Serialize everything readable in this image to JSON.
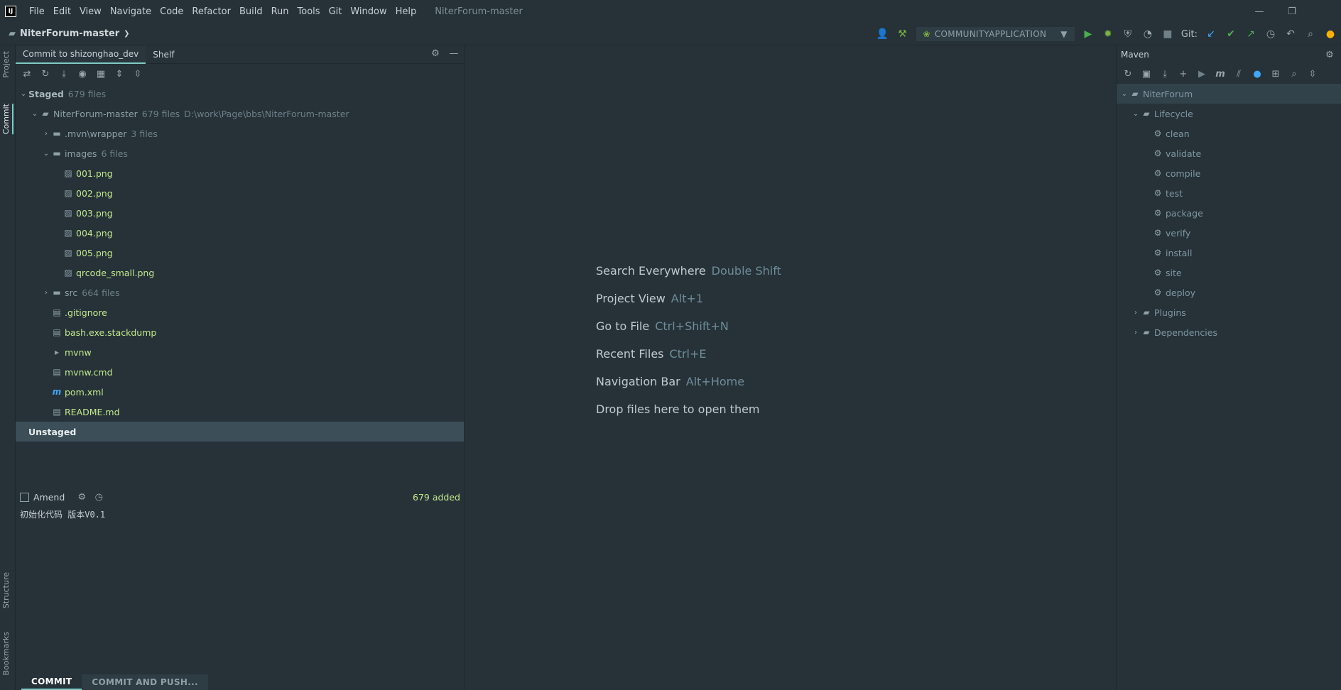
{
  "menu": [
    "File",
    "Edit",
    "View",
    "Navigate",
    "Code",
    "Refactor",
    "Build",
    "Run",
    "Tools",
    "Git",
    "Window",
    "Help"
  ],
  "window_title": "NiterForum-master",
  "breadcrumb": {
    "project": "NiterForum-master",
    "sep": "❯"
  },
  "run_config": "COMMUNITYAPPLICATION",
  "git_label": "Git:",
  "left_tabs": {
    "project": "Project",
    "commit": "Commit",
    "structure": "Structure",
    "bookmarks": "Bookmarks"
  },
  "commit_tabs": {
    "commit": "Commit to shizonghao_dev",
    "shelf": "Shelf"
  },
  "tree": {
    "staged": {
      "label": "Staged",
      "count": "679 files"
    },
    "root": {
      "label": "NiterForum-master",
      "count": "679 files",
      "path": "D:\\work\\Page\\bbs\\NiterForum-master"
    },
    "mvn": {
      "label": ".mvn\\wrapper",
      "count": "3 files"
    },
    "images": {
      "label": "images",
      "count": "6 files"
    },
    "image_files": [
      "001.png",
      "002.png",
      "003.png",
      "004.png",
      "005.png",
      "qrcode_small.png"
    ],
    "src": {
      "label": "src",
      "count": "664 files"
    },
    "root_files": [
      ".gitignore",
      "bash.exe.stackdump",
      "mvnw",
      "mvnw.cmd",
      "pom.xml",
      "README.md"
    ],
    "unstaged": "Unstaged"
  },
  "amend": {
    "label": "Amend",
    "added": "679 added"
  },
  "commit_message": "初始化代码 版本V0.1",
  "buttons": {
    "commit": "COMMIT",
    "commit_push": "COMMIT AND PUSH..."
  },
  "hints": [
    {
      "action": "Search Everywhere",
      "key": "Double Shift"
    },
    {
      "action": "Project View",
      "key": "Alt+1"
    },
    {
      "action": "Go to File",
      "key": "Ctrl+Shift+N"
    },
    {
      "action": "Recent Files",
      "key": "Ctrl+E"
    },
    {
      "action": "Navigation Bar",
      "key": "Alt+Home"
    },
    {
      "action": "Drop files here to open them",
      "key": ""
    }
  ],
  "maven": {
    "title": "Maven",
    "root": "NiterForum",
    "lifecycle": "Lifecycle",
    "goals": [
      "clean",
      "validate",
      "compile",
      "test",
      "package",
      "verify",
      "install",
      "site",
      "deploy"
    ],
    "plugins": "Plugins",
    "dependencies": "Dependencies"
  }
}
